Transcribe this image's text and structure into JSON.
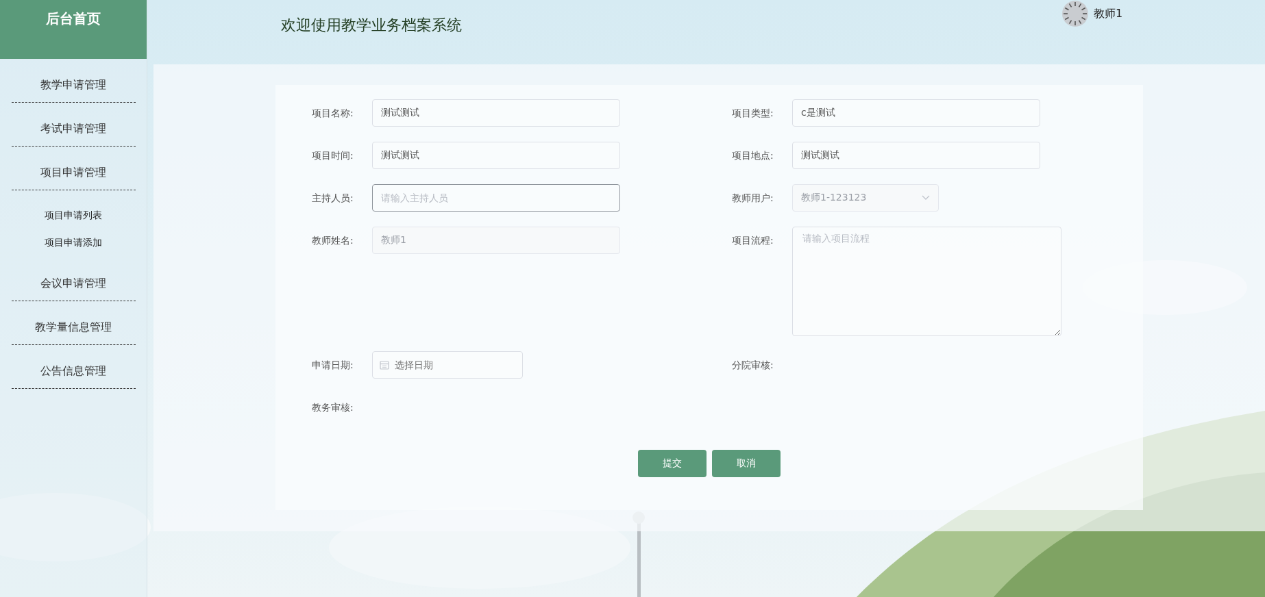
{
  "sidebar": {
    "title": "后台首页",
    "items": [
      {
        "label": "教学申请管理"
      },
      {
        "label": "考试申请管理"
      },
      {
        "label": "项目申请管理",
        "children": [
          {
            "label": "项目申请列表"
          },
          {
            "label": "项目申请添加"
          }
        ]
      },
      {
        "label": "会议申请管理"
      },
      {
        "label": "教学量信息管理"
      },
      {
        "label": "公告信息管理"
      }
    ]
  },
  "header": {
    "title": "欢迎使用教学业务档案系统",
    "user": {
      "name": "教师1"
    }
  },
  "form": {
    "rows": [
      [
        {
          "label": "项目名称:",
          "kind": "input",
          "value": "测试测试",
          "disabled": false,
          "focused": false
        },
        {
          "label": "项目类型:",
          "kind": "input",
          "value": "c是测试",
          "disabled": false,
          "focused": false
        }
      ],
      [
        {
          "label": "项目时间:",
          "kind": "input",
          "value": "测试测试",
          "disabled": false,
          "focused": false
        },
        {
          "label": "项目地点:",
          "kind": "input",
          "value": "测试测试",
          "disabled": false,
          "focused": false
        }
      ],
      [
        {
          "label": "主持人员:",
          "kind": "input",
          "placeholder": "请输入主持人员",
          "disabled": false,
          "focused": true
        },
        {
          "label": "教师用户:",
          "kind": "select",
          "value": "教师1-123123",
          "disabled": true,
          "focused": false
        }
      ],
      [
        {
          "label": "教师姓名:",
          "kind": "input",
          "value": "教师1",
          "disabled": true,
          "focused": false
        },
        {
          "label": "项目流程:",
          "kind": "textarea",
          "placeholder": "请输入项目流程",
          "disabled": false,
          "focused": false
        }
      ],
      [
        {
          "label": "申请日期:",
          "kind": "date",
          "placeholder": "选择日期",
          "disabled": false,
          "focused": false
        },
        {
          "label": "分院审核:",
          "kind": "display"
        }
      ],
      [
        {
          "label": "教务审核:",
          "kind": "display"
        }
      ]
    ],
    "buttons": [
      {
        "label": "提交"
      },
      {
        "label": "取消"
      }
    ]
  }
}
